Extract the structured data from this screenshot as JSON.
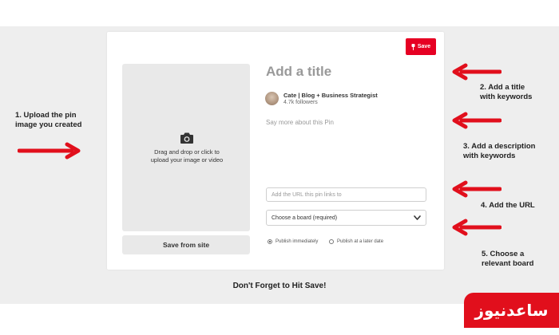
{
  "annotations": {
    "step1": [
      "1. Upload the pin",
      "image you created"
    ],
    "step2": [
      "2. Add a title",
      "with keywords"
    ],
    "step3": [
      "3. Add a description",
      "with keywords"
    ],
    "step4": "4. Add the URL",
    "step5": [
      "5. Choose a",
      "relevant board"
    ]
  },
  "pin_form": {
    "save_label": "Save",
    "upload_text": [
      "Drag and drop or click to",
      "upload your image or video"
    ],
    "save_from_site": "Save from site",
    "title_placeholder": "Add a title",
    "user_name": "Cate | Blog + Business Strategist",
    "followers": "4.7k followers",
    "description_placeholder": "Say more about this Pin",
    "url_placeholder": "Add the URL this pin links to",
    "board_select_value": "Choose a board (required)",
    "publish_options": [
      {
        "label": "Publish immediately",
        "selected": true
      },
      {
        "label": "Publish at a later date",
        "selected": false
      }
    ]
  },
  "footer": "Don't Forget to Hit Save!",
  "watermark": "ساعدنیوز",
  "colors": {
    "accent": "#e60023",
    "arrow": "#e10f1c",
    "background": "#eeeeee",
    "logo_bg": "#e10f1c"
  },
  "icons": {
    "camera": "camera-icon",
    "pin": "pin-icon",
    "chevron": "chevron-down-icon",
    "arrow": "arrow-icon"
  }
}
